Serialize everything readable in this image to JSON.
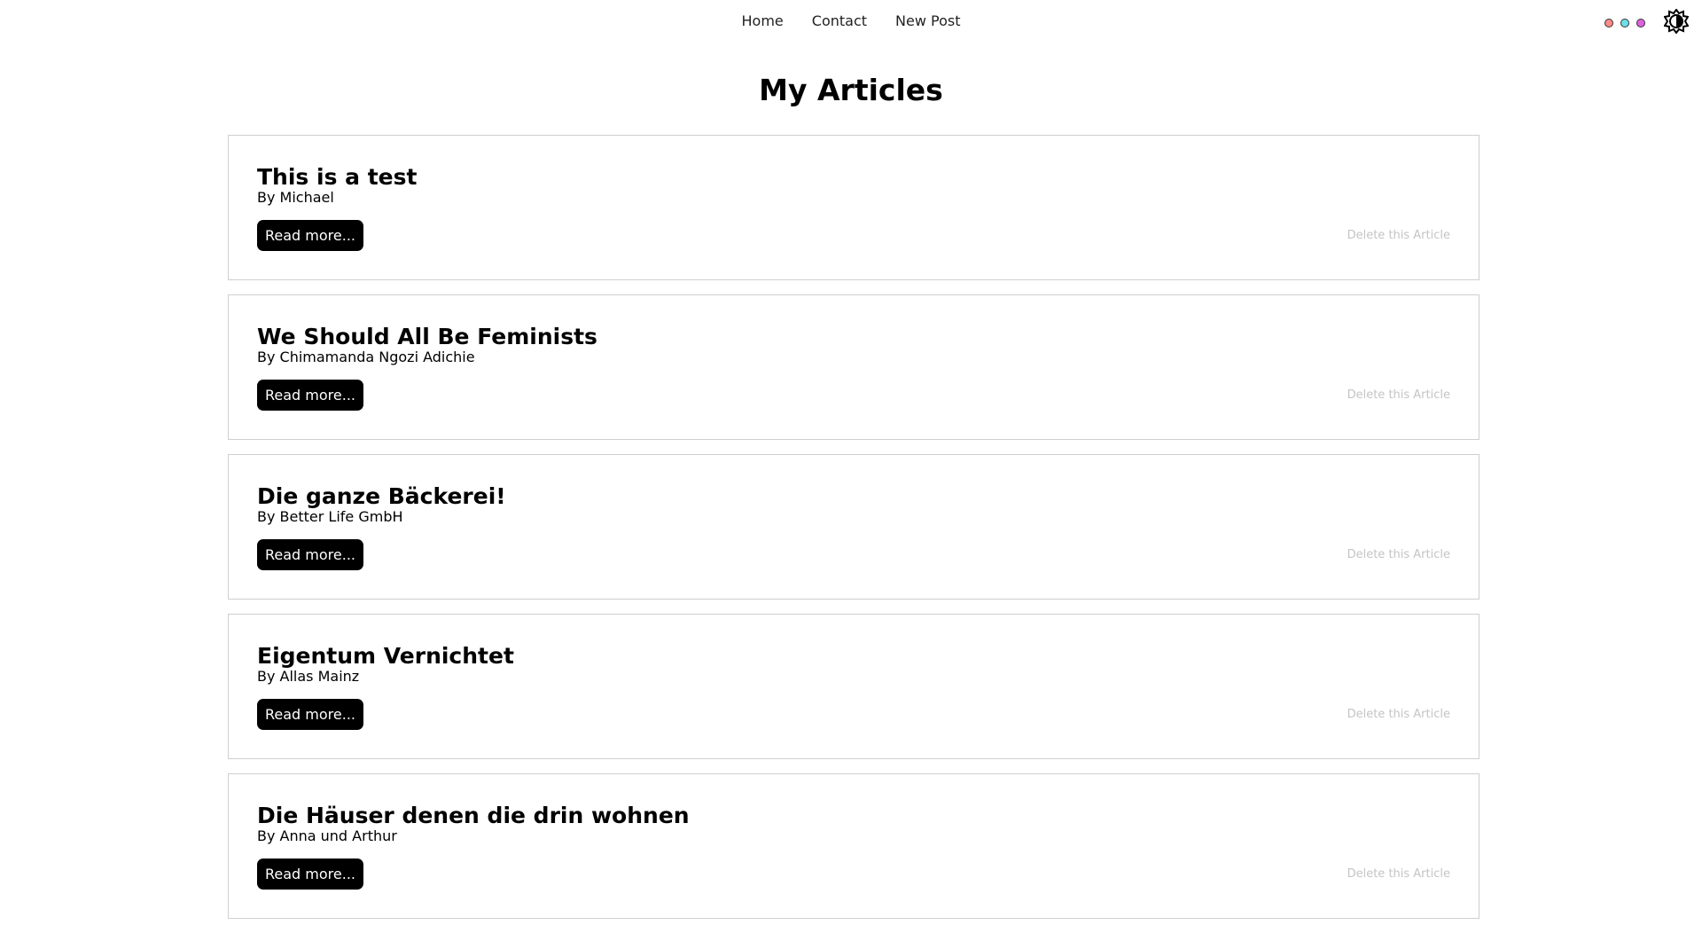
{
  "nav": {
    "links": [
      "Home",
      "Contact",
      "New Post"
    ]
  },
  "theme": {
    "dot_colors": [
      "#ff8a8a",
      "#6ee0e6",
      "#e060e0"
    ],
    "toggle_icon": "sun-moon-icon"
  },
  "page": {
    "title": "My Articles"
  },
  "articles": [
    {
      "title": "This is a test",
      "author": "By Michael",
      "read_label": "Read more...",
      "delete_label": "Delete this Article"
    },
    {
      "title": "We Should All Be Feminists",
      "author": "By Chimamanda Ngozi Adichie",
      "read_label": "Read more...",
      "delete_label": "Delete this Article"
    },
    {
      "title": "Die ganze Bäckerei!",
      "author": "By Better Life GmbH",
      "read_label": "Read more...",
      "delete_label": "Delete this Article"
    },
    {
      "title": "Eigentum Vernichtet",
      "author": "By Allas Mainz",
      "read_label": "Read more...",
      "delete_label": "Delete this Article"
    },
    {
      "title": "Die Häuser denen die drin wohnen",
      "author": "By Anna und Arthur",
      "read_label": "Read more...",
      "delete_label": "Delete this Article"
    }
  ]
}
